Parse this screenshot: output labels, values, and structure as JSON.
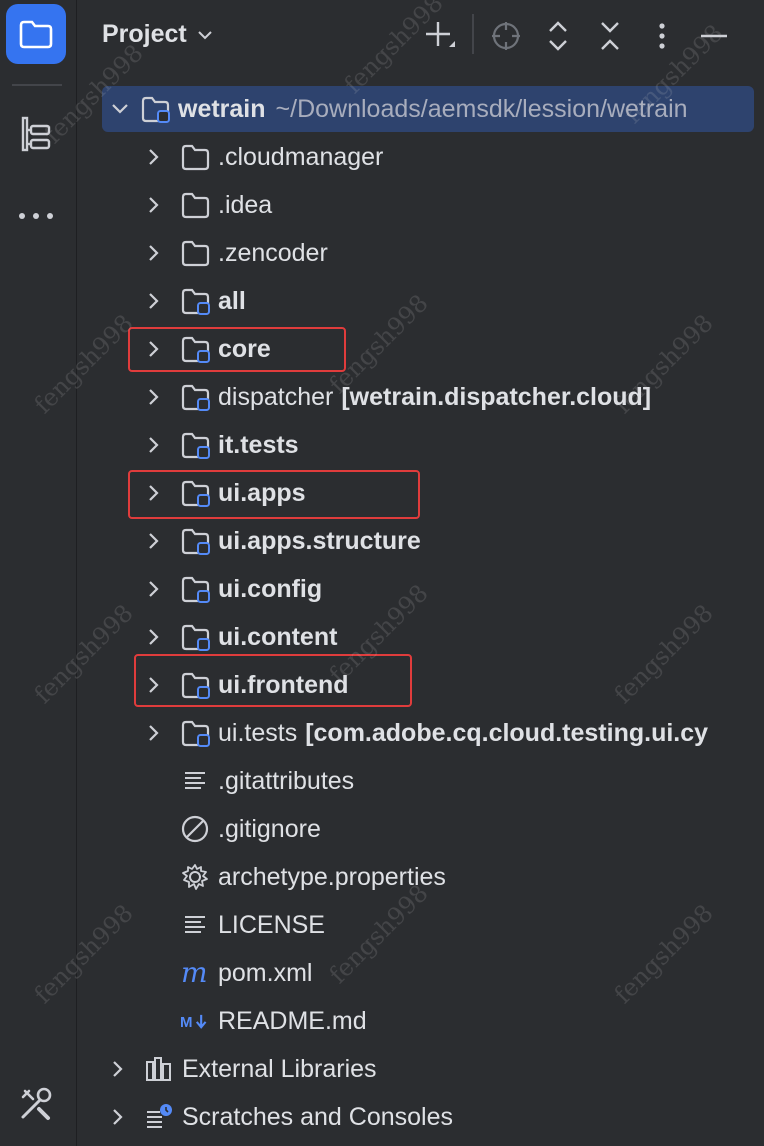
{
  "rail": {
    "items": [
      {
        "icon": "folder-icon",
        "active": true
      },
      {
        "icon": "structure-icon",
        "active": false
      },
      {
        "icon": "more-icon",
        "active": false
      }
    ],
    "bottom_icon": "tools-icon"
  },
  "header": {
    "title": "Project",
    "actions": [
      "add-icon",
      "locate-icon",
      "expand-collapse-icon",
      "collapse-all-icon",
      "options-icon",
      "hide-icon"
    ]
  },
  "tree": {
    "root": {
      "name": "wetrain",
      "path": "~/Downloads/aemsdk/lession/wetrain"
    },
    "children": [
      {
        "name": ".cloudmanager",
        "type": "folder"
      },
      {
        "name": ".idea",
        "type": "folder"
      },
      {
        "name": ".zencoder",
        "type": "folder"
      },
      {
        "name": "all",
        "type": "module"
      },
      {
        "name": "core",
        "type": "module"
      },
      {
        "name": "dispatcher",
        "type": "module",
        "extra": "[wetrain.dispatcher.cloud]"
      },
      {
        "name": "it.tests",
        "type": "module"
      },
      {
        "name": "ui.apps",
        "type": "module"
      },
      {
        "name": "ui.apps.structure",
        "type": "module"
      },
      {
        "name": "ui.config",
        "type": "module"
      },
      {
        "name": "ui.content",
        "type": "module"
      },
      {
        "name": "ui.frontend",
        "type": "module"
      },
      {
        "name": "ui.tests",
        "type": "module",
        "extra": "[com.adobe.cq.cloud.testing.ui.cy"
      },
      {
        "name": ".gitattributes",
        "type": "text-file"
      },
      {
        "name": ".gitignore",
        "type": "ignore-file"
      },
      {
        "name": "archetype.properties",
        "type": "properties-file"
      },
      {
        "name": "LICENSE",
        "type": "text-file"
      },
      {
        "name": "pom.xml",
        "type": "maven-file"
      },
      {
        "name": "README.md",
        "type": "markdown-file"
      }
    ],
    "external_libraries": "External Libraries",
    "scratches": "Scratches and Consoles"
  },
  "highlighted": [
    "core",
    "ui.apps",
    "ui.frontend"
  ],
  "watermark": "fengsh998",
  "colors": {
    "background": "#2b2d30",
    "selection": "#2e436e",
    "accent": "#3574f0",
    "highlight_box": "#e03c3c",
    "module_badge": "#548af7"
  }
}
